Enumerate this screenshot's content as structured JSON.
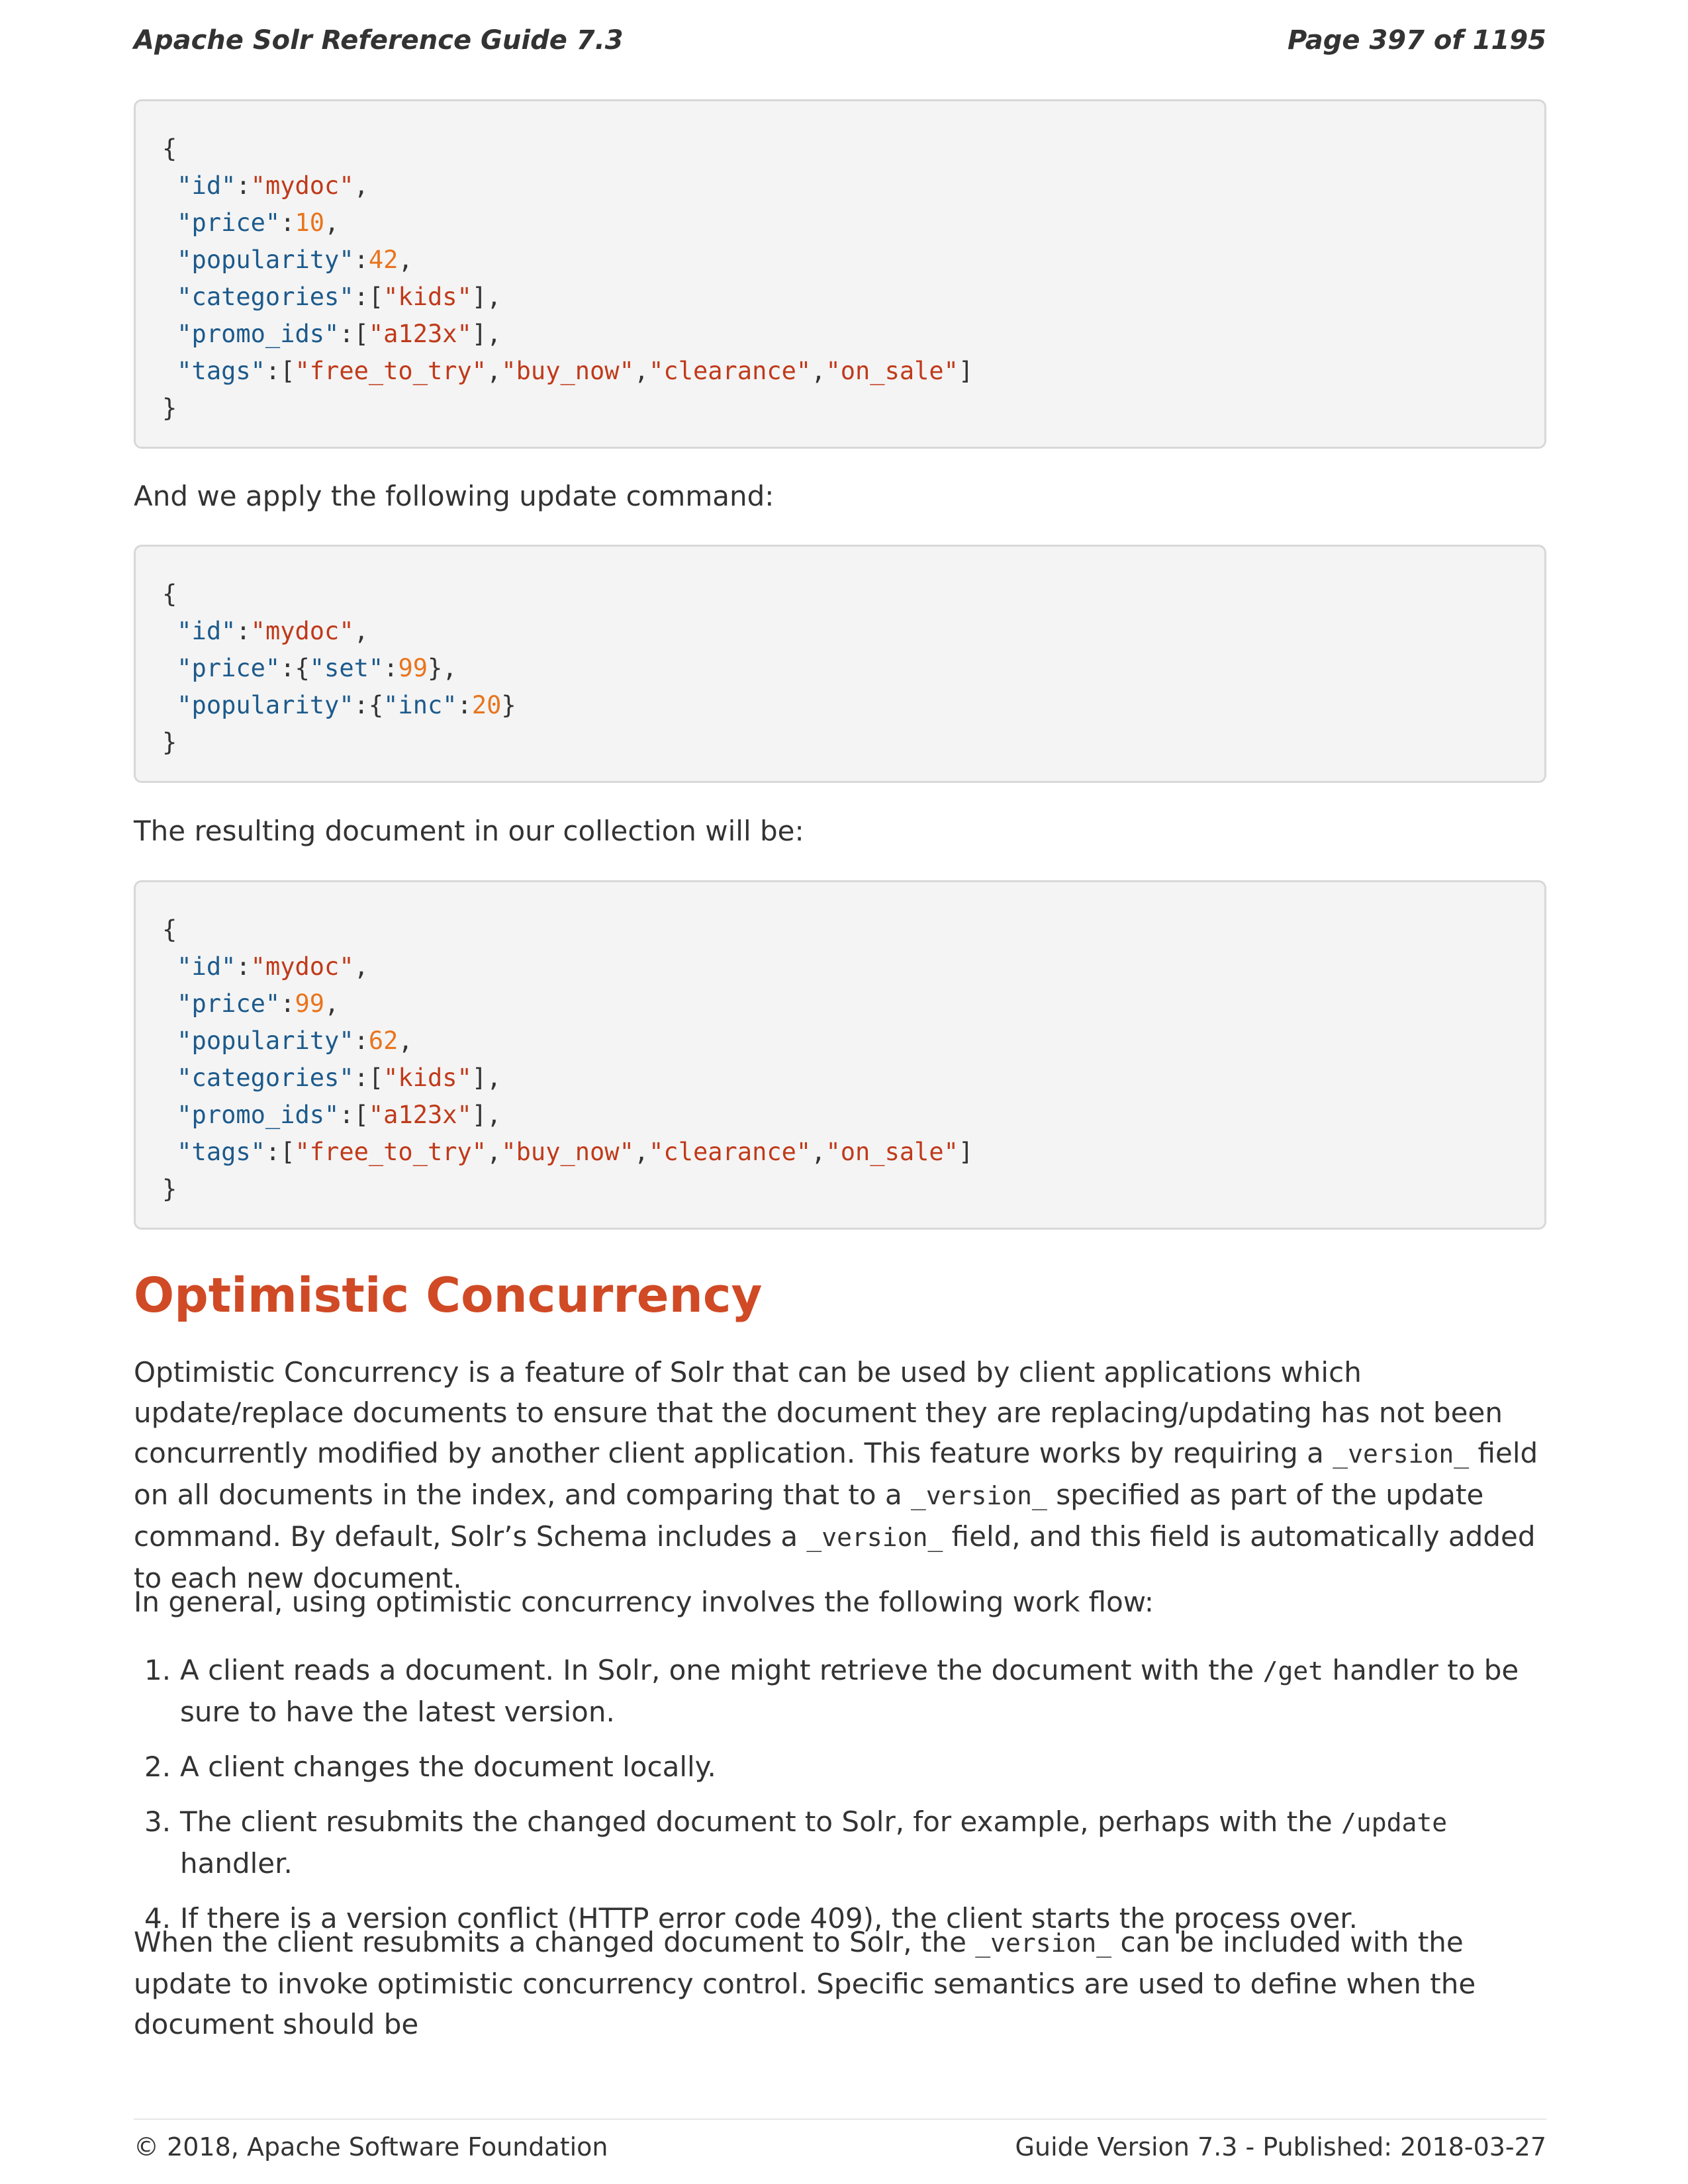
{
  "header": {
    "title": "Apache Solr Reference Guide 7.3",
    "page": "Page 397 of 1195"
  },
  "code_blocks": [
    {
      "lines": [
        [
          {
            "t": "p",
            "v": "{"
          }
        ],
        [
          {
            "t": "p",
            "v": " "
          },
          {
            "t": "k",
            "v": "\"id\""
          },
          {
            "t": "p",
            "v": ":"
          },
          {
            "t": "s",
            "v": "\"mydoc\""
          },
          {
            "t": "p",
            "v": ","
          }
        ],
        [
          {
            "t": "p",
            "v": " "
          },
          {
            "t": "k",
            "v": "\"price\""
          },
          {
            "t": "p",
            "v": ":"
          },
          {
            "t": "n",
            "v": "10"
          },
          {
            "t": "p",
            "v": ","
          }
        ],
        [
          {
            "t": "p",
            "v": " "
          },
          {
            "t": "k",
            "v": "\"popularity\""
          },
          {
            "t": "p",
            "v": ":"
          },
          {
            "t": "n",
            "v": "42"
          },
          {
            "t": "p",
            "v": ","
          }
        ],
        [
          {
            "t": "p",
            "v": " "
          },
          {
            "t": "k",
            "v": "\"categories\""
          },
          {
            "t": "p",
            "v": ":["
          },
          {
            "t": "s",
            "v": "\"kids\""
          },
          {
            "t": "p",
            "v": "],"
          }
        ],
        [
          {
            "t": "p",
            "v": " "
          },
          {
            "t": "k",
            "v": "\"promo_ids\""
          },
          {
            "t": "p",
            "v": ":["
          },
          {
            "t": "s",
            "v": "\"a123x\""
          },
          {
            "t": "p",
            "v": "],"
          }
        ],
        [
          {
            "t": "p",
            "v": " "
          },
          {
            "t": "k",
            "v": "\"tags\""
          },
          {
            "t": "p",
            "v": ":["
          },
          {
            "t": "s",
            "v": "\"free_to_try\""
          },
          {
            "t": "p",
            "v": ","
          },
          {
            "t": "s",
            "v": "\"buy_now\""
          },
          {
            "t": "p",
            "v": ","
          },
          {
            "t": "s",
            "v": "\"clearance\""
          },
          {
            "t": "p",
            "v": ","
          },
          {
            "t": "s",
            "v": "\"on_sale\""
          },
          {
            "t": "p",
            "v": "]"
          }
        ],
        [
          {
            "t": "p",
            "v": "}"
          }
        ]
      ]
    },
    {
      "lines": [
        [
          {
            "t": "p",
            "v": "{"
          }
        ],
        [
          {
            "t": "p",
            "v": " "
          },
          {
            "t": "k",
            "v": "\"id\""
          },
          {
            "t": "p",
            "v": ":"
          },
          {
            "t": "s",
            "v": "\"mydoc\""
          },
          {
            "t": "p",
            "v": ","
          }
        ],
        [
          {
            "t": "p",
            "v": " "
          },
          {
            "t": "k",
            "v": "\"price\""
          },
          {
            "t": "p",
            "v": ":{"
          },
          {
            "t": "k",
            "v": "\"set\""
          },
          {
            "t": "p",
            "v": ":"
          },
          {
            "t": "n",
            "v": "99"
          },
          {
            "t": "p",
            "v": "},"
          }
        ],
        [
          {
            "t": "p",
            "v": " "
          },
          {
            "t": "k",
            "v": "\"popularity\""
          },
          {
            "t": "p",
            "v": ":{"
          },
          {
            "t": "k",
            "v": "\"inc\""
          },
          {
            "t": "p",
            "v": ":"
          },
          {
            "t": "n",
            "v": "20"
          },
          {
            "t": "p",
            "v": "}"
          }
        ],
        [
          {
            "t": "p",
            "v": "}"
          }
        ]
      ]
    },
    {
      "lines": [
        [
          {
            "t": "p",
            "v": "{"
          }
        ],
        [
          {
            "t": "p",
            "v": " "
          },
          {
            "t": "k",
            "v": "\"id\""
          },
          {
            "t": "p",
            "v": ":"
          },
          {
            "t": "s",
            "v": "\"mydoc\""
          },
          {
            "t": "p",
            "v": ","
          }
        ],
        [
          {
            "t": "p",
            "v": " "
          },
          {
            "t": "k",
            "v": "\"price\""
          },
          {
            "t": "p",
            "v": ":"
          },
          {
            "t": "n",
            "v": "99"
          },
          {
            "t": "p",
            "v": ","
          }
        ],
        [
          {
            "t": "p",
            "v": " "
          },
          {
            "t": "k",
            "v": "\"popularity\""
          },
          {
            "t": "p",
            "v": ":"
          },
          {
            "t": "n",
            "v": "62"
          },
          {
            "t": "p",
            "v": ","
          }
        ],
        [
          {
            "t": "p",
            "v": " "
          },
          {
            "t": "k",
            "v": "\"categories\""
          },
          {
            "t": "p",
            "v": ":["
          },
          {
            "t": "s",
            "v": "\"kids\""
          },
          {
            "t": "p",
            "v": "],"
          }
        ],
        [
          {
            "t": "p",
            "v": " "
          },
          {
            "t": "k",
            "v": "\"promo_ids\""
          },
          {
            "t": "p",
            "v": ":["
          },
          {
            "t": "s",
            "v": "\"a123x\""
          },
          {
            "t": "p",
            "v": "],"
          }
        ],
        [
          {
            "t": "p",
            "v": " "
          },
          {
            "t": "k",
            "v": "\"tags\""
          },
          {
            "t": "p",
            "v": ":["
          },
          {
            "t": "s",
            "v": "\"free_to_try\""
          },
          {
            "t": "p",
            "v": ","
          },
          {
            "t": "s",
            "v": "\"buy_now\""
          },
          {
            "t": "p",
            "v": ","
          },
          {
            "t": "s",
            "v": "\"clearance\""
          },
          {
            "t": "p",
            "v": ","
          },
          {
            "t": "s",
            "v": "\"on_sale\""
          },
          {
            "t": "p",
            "v": "]"
          }
        ],
        [
          {
            "t": "p",
            "v": "}"
          }
        ]
      ]
    }
  ],
  "intro_update": "And we apply the following update command:",
  "intro_result": "The resulting document in our collection will be:",
  "section": {
    "title": "Optimistic Concurrency",
    "p1": [
      "Optimistic Concurrency is a feature of Solr that can be used by client applications which update/replace documents to ensure that the document they are replacing/updating has not been concurrently modified by another client application. This feature works by requiring a ",
      "_version_",
      " field on all documents in the index, and comparing that to a ",
      "_version_",
      " specified as part of the update command. By default, Solr’s Schema includes a ",
      "_version_",
      " field, and this field is automatically added to each new document."
    ],
    "p2": "In general, using optimistic concurrency involves the following work flow:",
    "steps": [
      {
        "num": "1.",
        "parts": [
          "A client reads a document. In Solr, one might retrieve the document with the ",
          "/get",
          " handler to be sure to have the latest version."
        ]
      },
      {
        "num": "2.",
        "parts": [
          "A client changes the document locally."
        ]
      },
      {
        "num": "3.",
        "parts": [
          "The client resubmits the changed document to Solr, for example, perhaps with the ",
          "/update",
          " handler."
        ]
      },
      {
        "num": "4.",
        "parts": [
          "If there is a version conflict (HTTP error code 409), the client starts the process over."
        ]
      }
    ],
    "p3": [
      "When the client resubmits a changed document to Solr, the ",
      "_version_",
      " can be included with the update to invoke optimistic concurrency control. Specific semantics are used to define when the document should be"
    ]
  },
  "footer": {
    "copyright": "© 2018, Apache Software Foundation",
    "version": "Guide Version 7.3 - Published: 2018-03-27"
  },
  "colors": {
    "heading": "#d04a25",
    "code_key": "#1c5a8c",
    "code_string": "#c03a1a",
    "code_number": "#e9741c",
    "code_bg": "#f4f4f4"
  }
}
